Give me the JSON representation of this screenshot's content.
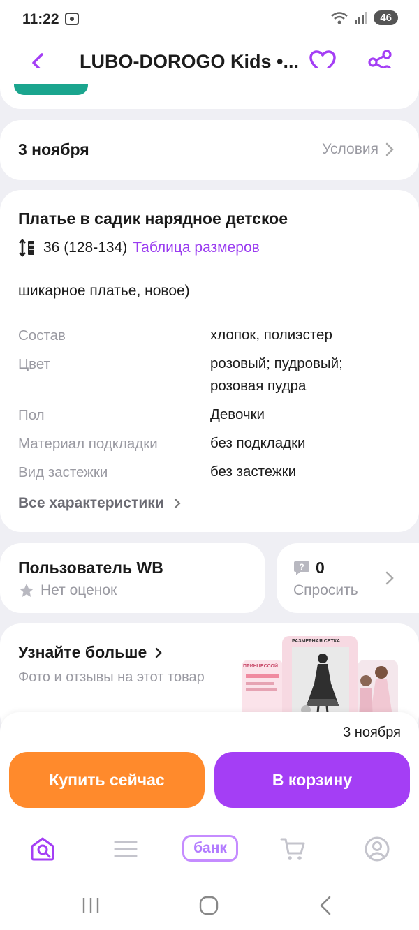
{
  "status_bar": {
    "time": "11:22",
    "network_badge": "46"
  },
  "header": {
    "title": "LUBO-DOROGO Kids •..."
  },
  "delivery_card": {
    "date": "3 ноября",
    "terms_label": "Условия"
  },
  "product": {
    "title": "Платье в садик нарядное детское",
    "size": "36 (128-134)",
    "size_table_link": "Таблица размеров",
    "description": "шикарное платье, новое)",
    "attributes": [
      {
        "key": "Состав",
        "value": "хлопок, полиэстер"
      },
      {
        "key": "Цвет",
        "value": "розовый; пудровый;",
        "value2": "розовая пудра"
      },
      {
        "key": "Пол",
        "value": "Девочки"
      },
      {
        "key": "Материал подкладки",
        "value": "без подкладки"
      },
      {
        "key": "Вид застежки",
        "value": "без застежки"
      }
    ],
    "all_attributes_label": "Все характеристики"
  },
  "seller": {
    "name": "Пользователь WB",
    "rating_text": "Нет оценок"
  },
  "questions": {
    "count": "0",
    "label": "Спросить"
  },
  "learn_more": {
    "title": "Узнайте больше",
    "subtitle": "Фото и отзывы на этот товар",
    "thumb_caption": "РАЗМЕРНАЯ СЕТКА:",
    "thumb_left_caption": "ПРИНЦЕССОЙ"
  },
  "action_bar": {
    "delivery_date": "3 ноября",
    "buy_now": "Купить сейчас",
    "add_to_cart": "В корзину"
  },
  "tab_bar": {
    "bank_label": "банк"
  },
  "colors": {
    "accent": "#a43ef5",
    "buy": "#ff8a2c",
    "link": "#9a3cf0",
    "teal": "#1aa58e"
  }
}
